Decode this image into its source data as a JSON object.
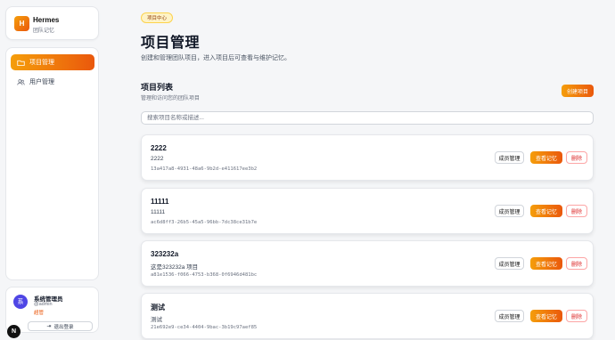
{
  "brand": {
    "logo_letter": "H",
    "title": "Hermes",
    "subtitle": "团队记忆"
  },
  "nav": {
    "items": [
      {
        "label": "项目管理",
        "icon": "folder-icon",
        "active": true
      },
      {
        "label": "用户管理",
        "icon": "users-icon",
        "active": false
      }
    ]
  },
  "user": {
    "avatar_letter": "系",
    "name": "系统管理员",
    "handle": "@admin",
    "role": "超管",
    "logout_label": "退出登录"
  },
  "corner_badge": "N",
  "header": {
    "pill": "项目中心",
    "title": "项目管理",
    "description": "创建和管理团队项目，进入项目后可查看与维护记忆。"
  },
  "section": {
    "title": "项目列表",
    "subtitle": "管理和访问您的团队项目",
    "create_label": "创建项目"
  },
  "search": {
    "placeholder": "搜索项目名称或描述..."
  },
  "actions": {
    "members": "成员管理",
    "view": "查看记忆",
    "delete": "删除"
  },
  "projects": [
    {
      "name": "2222",
      "description": "2222",
      "id": "13a417a8-4931-48a6-9b2d-e411617ee3b2"
    },
    {
      "name": "11111",
      "description": "11111",
      "id": "ac6d8ff3-26b5-45a5-96bb-7dc38ce31b7e"
    },
    {
      "name": "323232a",
      "description": "这是323232a 项目",
      "id": "a81e1536-f066-4753-b368-0f6946d481bc"
    },
    {
      "name": "测试",
      "description": "测试",
      "id": "21e692e9-ce34-4404-9bac-3b19c97aef85"
    }
  ],
  "colors": {
    "accent": "#ea580c",
    "accent_light": "#f59e0b",
    "danger": "#dc2626"
  }
}
